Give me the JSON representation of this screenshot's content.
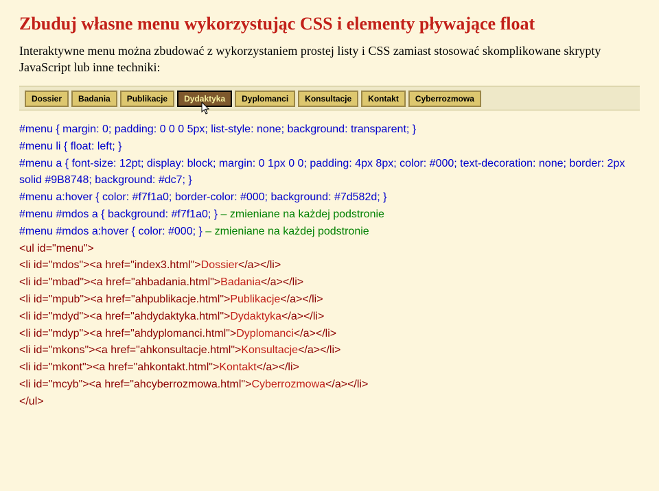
{
  "title": "Zbuduj własne menu wykorzystując CSS i elementy pływające float",
  "intro": "Interaktywne menu można zbudować z wykorzystaniem prostej listy i CSS zamiast stosować skomplikowane skrypty JavaScript lub inne techniki:",
  "menu": {
    "items": [
      {
        "label": "Dossier",
        "active": false
      },
      {
        "label": "Badania",
        "active": false
      },
      {
        "label": "Publikacje",
        "active": false
      },
      {
        "label": "Dydaktyka",
        "active": true
      },
      {
        "label": "Dyplomanci",
        "active": false
      },
      {
        "label": "Konsultacje",
        "active": false
      },
      {
        "label": "Kontakt",
        "active": false
      },
      {
        "label": "Cyberrozmowa",
        "active": false
      }
    ]
  },
  "code": {
    "css1": "#menu { margin: 0; padding: 0 0 0 5px; list-style: none; background: transparent; }",
    "css2": "#menu li { float: left; }",
    "css3": "#menu a { font-size: 12pt; display: block; margin: 0 1px 0 0; padding: 4px 8px; color: #000; text-decoration: none; border: 2px solid #9B8748; background: #dc7; }",
    "css4": "#menu a:hover { color: #f7f1a0; border-color: #000; background: #7d582d; }",
    "css5a": "#menu #mdos a { background: #f7f1a0; }",
    "css5b": " – zmieniane na każdej podstronie",
    "css6a": "#menu #mdos a:hover { color: #000; }",
    "css6b": " – zmieniane na każdej podstronie",
    "html_ul_open": "<ul id=\"menu\">",
    "html_li": [
      {
        "li": "<li id=\"mdos\"><a href=\"index3.html\">",
        "txt": "Dossier",
        "end": "</a></li>"
      },
      {
        "li": "<li id=\"mbad\"><a href=\"ahbadania.html\">",
        "txt": "Badania",
        "end": "</a></li>"
      },
      {
        "li": "<li id=\"mpub\"><a href=\"ahpublikacje.html\">",
        "txt": "Publikacje",
        "end": "</a></li>"
      },
      {
        "li": "<li id=\"mdyd\"><a href=\"ahdydaktyka.html\">",
        "txt": "Dydaktyka",
        "end": "</a></li>"
      },
      {
        "li": "<li id=\"mdyp\"><a href=\"ahdyplomanci.html\">",
        "txt": "Dyplomanci",
        "end": "</a></li>"
      },
      {
        "li": "<li id=\"mkons\"><a href=\"ahkonsultacje.html\">",
        "txt": "Konsultacje",
        "end": "</a></li>"
      },
      {
        "li": "<li id=\"mkont\"><a href=\"ahkontakt.html\">",
        "txt": "Kontakt",
        "end": "</a></li>"
      },
      {
        "li": "<li id=\"mcyb\"><a href=\"ahcyberrozmowa.html\">",
        "txt": "Cyberrozmowa",
        "end": "</a></li>"
      }
    ],
    "html_ul_close": "</ul>"
  }
}
